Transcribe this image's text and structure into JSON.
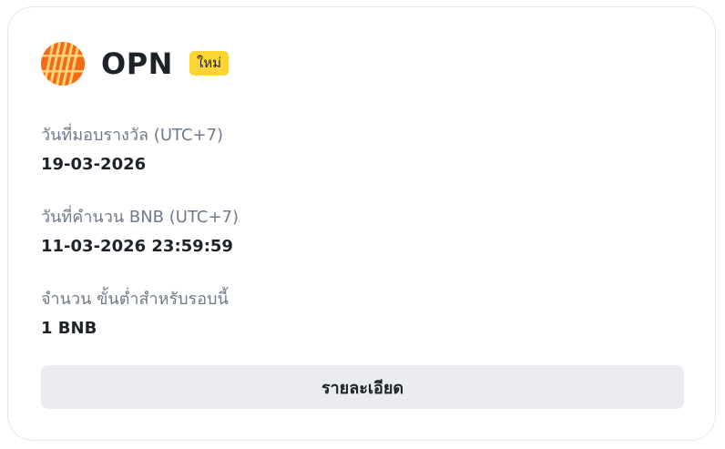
{
  "token": {
    "name": "OPN",
    "badge": "ใหม่",
    "icon": "opn-token-icon",
    "icon_color": "#f36b16"
  },
  "fields": [
    {
      "label": "วันที่มอบรางวัล (UTC+7)",
      "value": "19-03-2026"
    },
    {
      "label": "วันที่คำนวน BNB (UTC+7)",
      "value": "11-03-2026 23:59:59"
    },
    {
      "label": "จำนวน ขั้นต่ำสำหรับรอบนี้",
      "value": "1 BNB"
    }
  ],
  "details_button": "รายละเอียด",
  "colors": {
    "badge_bg": "#fcd535",
    "label_text": "#707a8a",
    "value_text": "#1e2329",
    "button_bg": "#eaecef"
  }
}
